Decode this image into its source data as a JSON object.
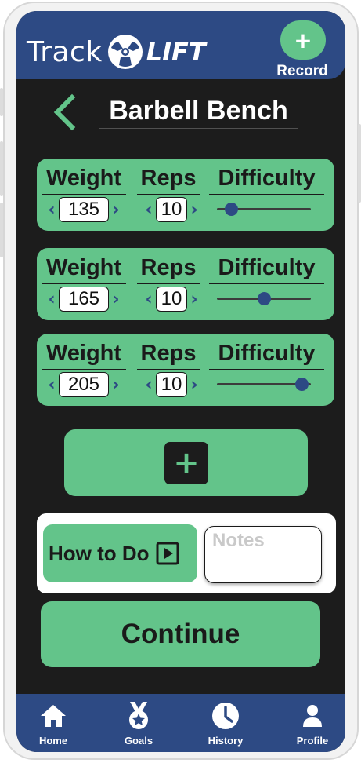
{
  "header": {
    "brand_track": "Track",
    "brand_lift": "LIFT",
    "record_icon": "plus-icon",
    "record_label": "Record"
  },
  "exercise": {
    "title": "Barbell Bench"
  },
  "columns": {
    "weight": "Weight",
    "reps": "Reps",
    "difficulty": "Difficulty"
  },
  "sets": [
    {
      "weight": "135",
      "reps": "10",
      "difficulty": 0.15
    },
    {
      "weight": "165",
      "reps": "10",
      "difficulty": 0.5
    },
    {
      "weight": "205",
      "reps": "10",
      "difficulty": 0.9
    }
  ],
  "add_set": {
    "icon": "plus-icon"
  },
  "info": {
    "how_to_label": "How to Do",
    "notes_placeholder": "Notes"
  },
  "continue_label": "Continue",
  "nav": [
    {
      "label": "Home",
      "icon": "home-icon"
    },
    {
      "label": "Goals",
      "icon": "medal-icon"
    },
    {
      "label": "History",
      "icon": "clock-icon"
    },
    {
      "label": "Profile",
      "icon": "person-icon"
    }
  ],
  "colors": {
    "primary_blue": "#2d4a84",
    "accent_green": "#63c48a",
    "background_dark": "#1c1c1c"
  }
}
